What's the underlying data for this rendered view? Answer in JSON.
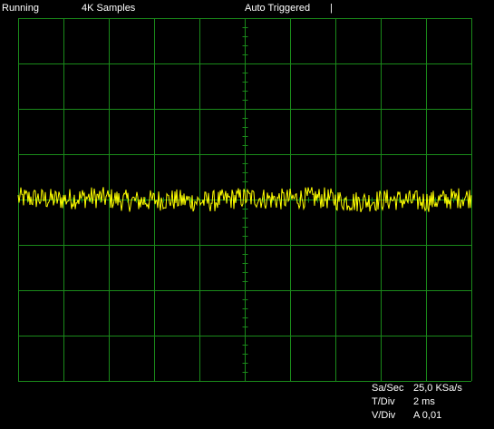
{
  "status": {
    "run_state": "Running",
    "samples": "4K Samples",
    "trigger": "Auto Triggered",
    "marker": "|"
  },
  "info": {
    "sa_sec_label": "Sa/Sec",
    "sa_sec_value": "25,0 KSa/s",
    "t_div_label": "T/Div",
    "t_div_value": "2 ms",
    "v_div_label": "V/Div",
    "v_div_value": "A 0,01"
  },
  "colors": {
    "background": "#000000",
    "grid": "#1a8a1a",
    "trace": "#ffff00",
    "text": "#ffffff"
  },
  "chart_data": {
    "type": "line",
    "series": [
      {
        "color": "#ffff00",
        "mean_level": 0.0,
        "noise_amplitude": 0.15
      }
    ],
    "grid": true,
    "divisions": {
      "x": 10,
      "y": 8
    }
  }
}
